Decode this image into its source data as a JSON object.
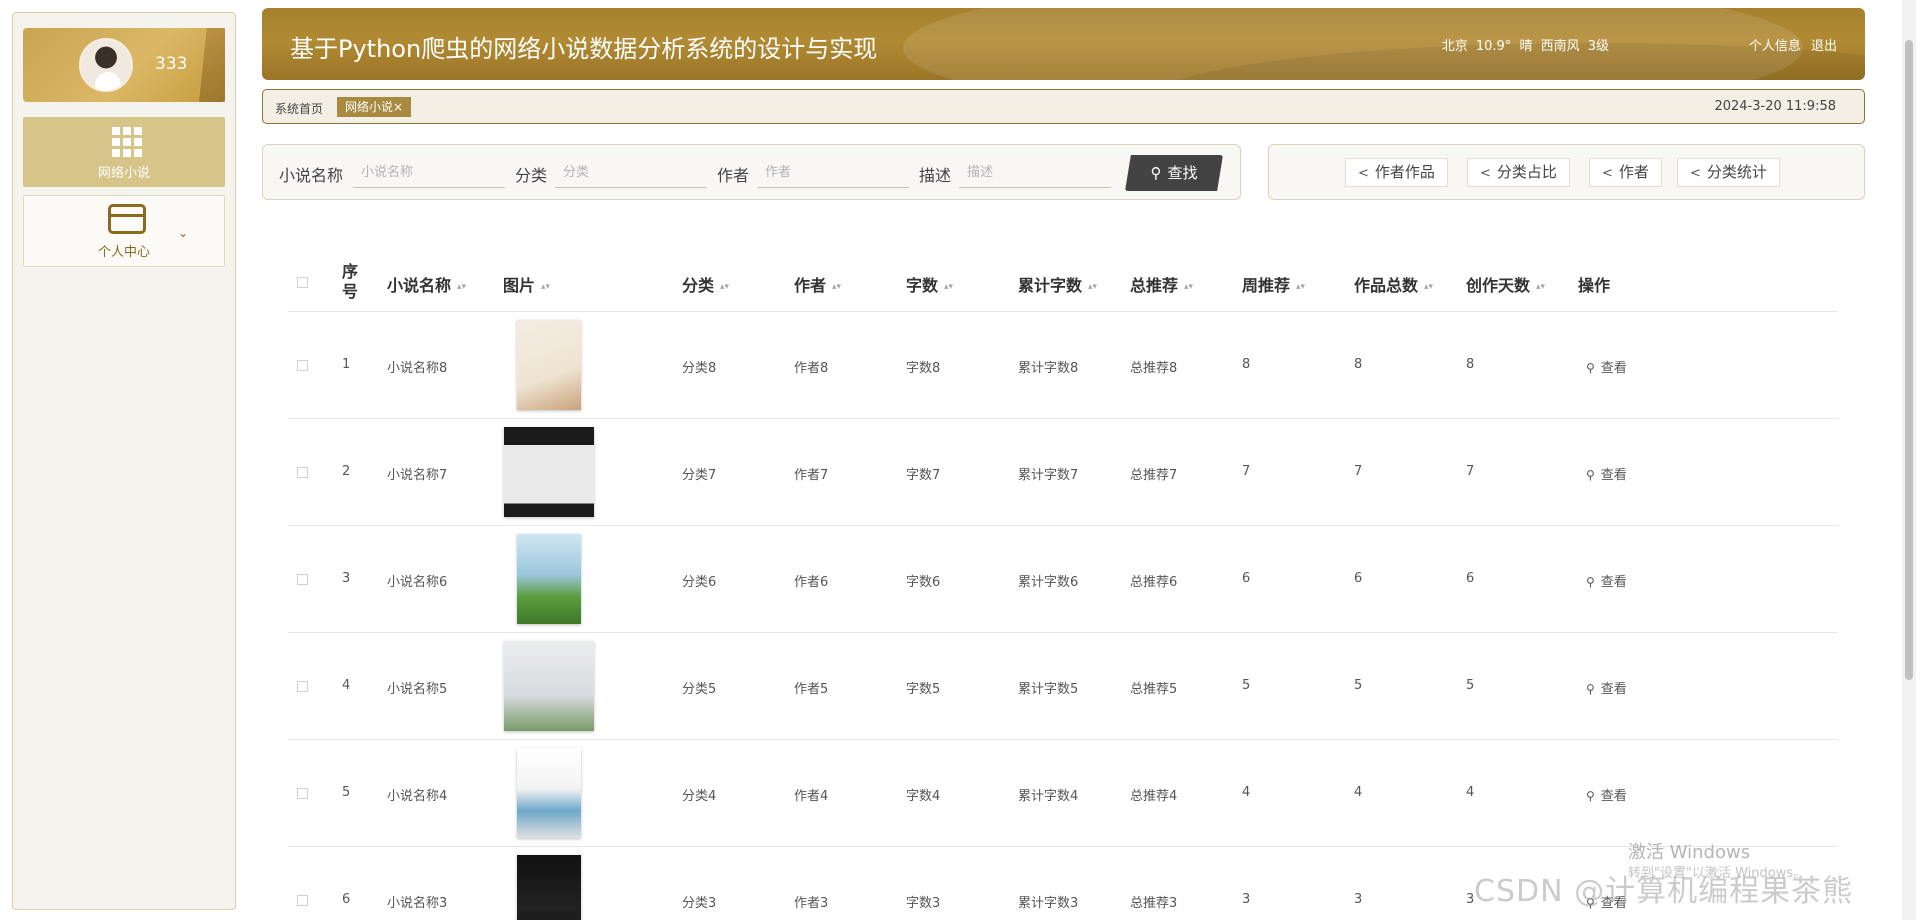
{
  "sidebar": {
    "user_name": "333",
    "menu": [
      {
        "label": "网络小说",
        "icon": "grid-icon",
        "active": true
      },
      {
        "label": "个人中心",
        "icon": "card-icon",
        "active": false
      }
    ]
  },
  "header": {
    "title": "基于Python爬虫的网络小说数据分析系统的设计与实现",
    "weather": "北京 10.9° 晴 西南风 3级",
    "profile_link": "个人信息",
    "logout_link": "退出"
  },
  "tabs": {
    "home": "系统首页",
    "active": "网络小说×",
    "datetime": "2024-3-20 11:9:58"
  },
  "search": {
    "fields": [
      {
        "label": "小说名称",
        "placeholder": "小说名称"
      },
      {
        "label": "分类",
        "placeholder": "分类"
      },
      {
        "label": "作者",
        "placeholder": "作者"
      },
      {
        "label": "描述",
        "placeholder": "描述"
      }
    ],
    "button": "查找"
  },
  "actions": [
    "作者作品",
    "分类占比",
    "作者",
    "分类统计"
  ],
  "table": {
    "headers": [
      "序号",
      "小说名称",
      "图片",
      "分类",
      "作者",
      "字数",
      "累计字数",
      "总推荐",
      "周推荐",
      "作品总数",
      "创作天数",
      "操作"
    ],
    "view_label": "查看",
    "rows": [
      {
        "idx": "1",
        "name": "小说名称8",
        "category": "分类8",
        "author": "作者8",
        "words": "字数8",
        "total_words": "累计字数8",
        "total_rec": "总推荐8",
        "week_rec": "8",
        "works": "8",
        "days": "8"
      },
      {
        "idx": "2",
        "name": "小说名称7",
        "category": "分类7",
        "author": "作者7",
        "words": "字数7",
        "total_words": "累计字数7",
        "total_rec": "总推荐7",
        "week_rec": "7",
        "works": "7",
        "days": "7"
      },
      {
        "idx": "3",
        "name": "小说名称6",
        "category": "分类6",
        "author": "作者6",
        "words": "字数6",
        "total_words": "累计字数6",
        "total_rec": "总推荐6",
        "week_rec": "6",
        "works": "6",
        "days": "6"
      },
      {
        "idx": "4",
        "name": "小说名称5",
        "category": "分类5",
        "author": "作者5",
        "words": "字数5",
        "total_words": "累计字数5",
        "total_rec": "总推荐5",
        "week_rec": "5",
        "works": "5",
        "days": "5"
      },
      {
        "idx": "5",
        "name": "小说名称4",
        "category": "分类4",
        "author": "作者4",
        "words": "字数4",
        "total_words": "累计字数4",
        "total_rec": "总推荐4",
        "week_rec": "4",
        "works": "4",
        "days": "4"
      },
      {
        "idx": "6",
        "name": "小说名称3",
        "category": "分类3",
        "author": "作者3",
        "words": "字数3",
        "total_words": "累计字数3",
        "total_rec": "总推荐3",
        "week_rec": "3",
        "works": "3",
        "days": "3"
      }
    ]
  },
  "watermarks": {
    "windows_line1": "激活 Windows",
    "windows_line2": "转到\"设置\"以激活 Windows。",
    "csdn": "CSDN @计算机编程果茶熊"
  },
  "colors": {
    "accent": "#a4812e",
    "sidebar_active": "#d6c489",
    "search_button": "#434343"
  }
}
